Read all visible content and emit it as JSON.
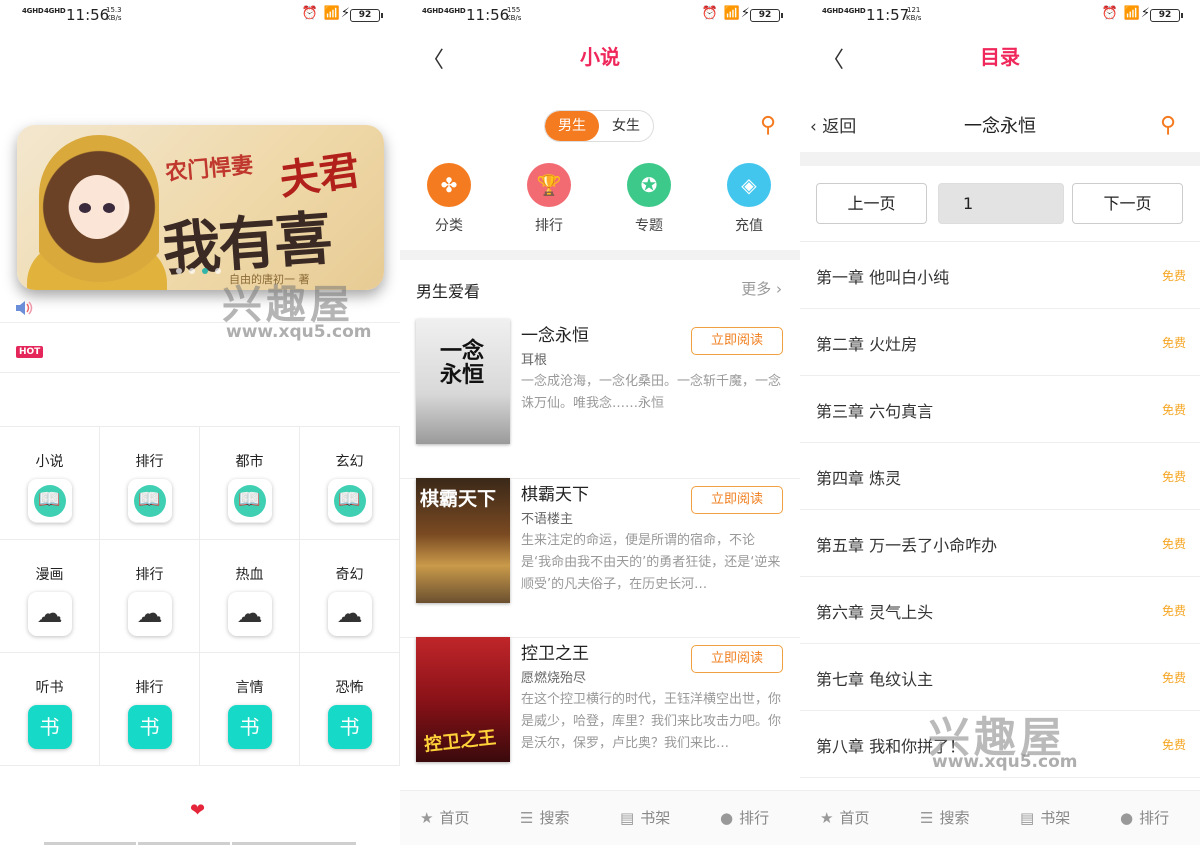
{
  "status_bars": [
    {
      "net1": "4GHD",
      "net2": "4GHD",
      "time": "11:56",
      "speed": "15.3",
      "speed_unit": "KB/s",
      "battery": "92"
    },
    {
      "net1": "4GHD",
      "net2": "4GHD",
      "time": "11:56",
      "speed": "155",
      "speed_unit": "KB/s",
      "battery": "92"
    },
    {
      "net1": "4GHD",
      "net2": "4GHD",
      "time": "11:57",
      "speed": "121",
      "speed_unit": "KB/s",
      "battery": "92"
    }
  ],
  "home": {
    "banner": {
      "line1": "农门悍妻",
      "line2": "夫君",
      "line3": "我有喜了",
      "author": "自由的唐初一 著",
      "dots": 4,
      "active_dot": 3
    },
    "watermark": "兴趣屋",
    "watermark_url": "www.xqu5.com",
    "hot_badge": "HOT",
    "grid": [
      {
        "label": "小说",
        "icon": "book-icon"
      },
      {
        "label": "排行",
        "icon": "book-icon"
      },
      {
        "label": "都市",
        "icon": "book-icon"
      },
      {
        "label": "玄幻",
        "icon": "book-icon"
      },
      {
        "label": "漫画",
        "icon": "cloud-icon"
      },
      {
        "label": "排行",
        "icon": "cloud-icon"
      },
      {
        "label": "热血",
        "icon": "cloud-icon"
      },
      {
        "label": "奇幻",
        "icon": "cloud-icon"
      },
      {
        "label": "听书",
        "icon": "headphone-icon"
      },
      {
        "label": "排行",
        "icon": "headphone-icon"
      },
      {
        "label": "言情",
        "icon": "headphone-icon"
      },
      {
        "label": "恐怖",
        "icon": "headphone-icon"
      }
    ],
    "headphone_glyph": "书"
  },
  "novel": {
    "title": "小说",
    "segments": [
      "男生",
      "女生"
    ],
    "active_segment": 0,
    "categories": [
      {
        "label": "分类",
        "icon": "grid-icon",
        "color": "#f47b20"
      },
      {
        "label": "排行",
        "icon": "trophy-icon",
        "color": "#f26b73"
      },
      {
        "label": "专题",
        "icon": "star-icon",
        "color": "#3dc98a"
      },
      {
        "label": "充值",
        "icon": "diamond-icon",
        "color": "#43c6ee"
      }
    ],
    "section_title": "男生爱看",
    "more_label": "更多",
    "read_label": "立即阅读",
    "books": [
      {
        "title": "一念永恒",
        "author": "耳根",
        "desc": "一念成沧海，一念化桑田。一念斩千魔，一念诛万仙。唯我念……永恒",
        "cover_text": "一念永恒"
      },
      {
        "title": "棋霸天下",
        "author": "不语楼主",
        "desc": "生来注定的命运，便是所谓的宿命，不论是‘我命由我不由天的’的勇者狂徒，还是‘逆来顺受’的凡夫俗子，在历史长河…",
        "cover_text": "棋霸天下"
      },
      {
        "title": "控卫之王",
        "author": "愿燃烧殆尽",
        "desc": "在这个控卫横行的时代，王钰洋横空出世，你是威少，哈登，库里？我们来比攻击力吧。你是沃尔，保罗，卢比奥？我们来比…",
        "cover_text": "控卫之王"
      }
    ]
  },
  "catalog": {
    "title": "目录",
    "back_label": "返回",
    "book_name": "一念永恒",
    "prev_label": "上一页",
    "page": "1",
    "next_label": "下一页",
    "free_label": "免费",
    "chapters": [
      "第一章 他叫白小纯",
      "第二章 火灶房",
      "第三章 六句真言",
      "第四章 炼灵",
      "第五章 万一丢了小命咋办",
      "第六章 灵气上头",
      "第七章 龟纹认主",
      "第八章 我和你拼了！"
    ],
    "watermark": "兴趣屋",
    "watermark_url": "www.xqu5.com"
  },
  "tabbar": [
    {
      "label": "首页",
      "icon": "star-icon"
    },
    {
      "label": "搜索",
      "icon": "search-stack-icon"
    },
    {
      "label": "书架",
      "icon": "bookshelf-icon"
    },
    {
      "label": "排行",
      "icon": "user-icon"
    }
  ],
  "colors": {
    "accent": "#f0275a",
    "orange": "#f47b20",
    "teal": "#3fd0b4",
    "free": "#f5a623"
  }
}
